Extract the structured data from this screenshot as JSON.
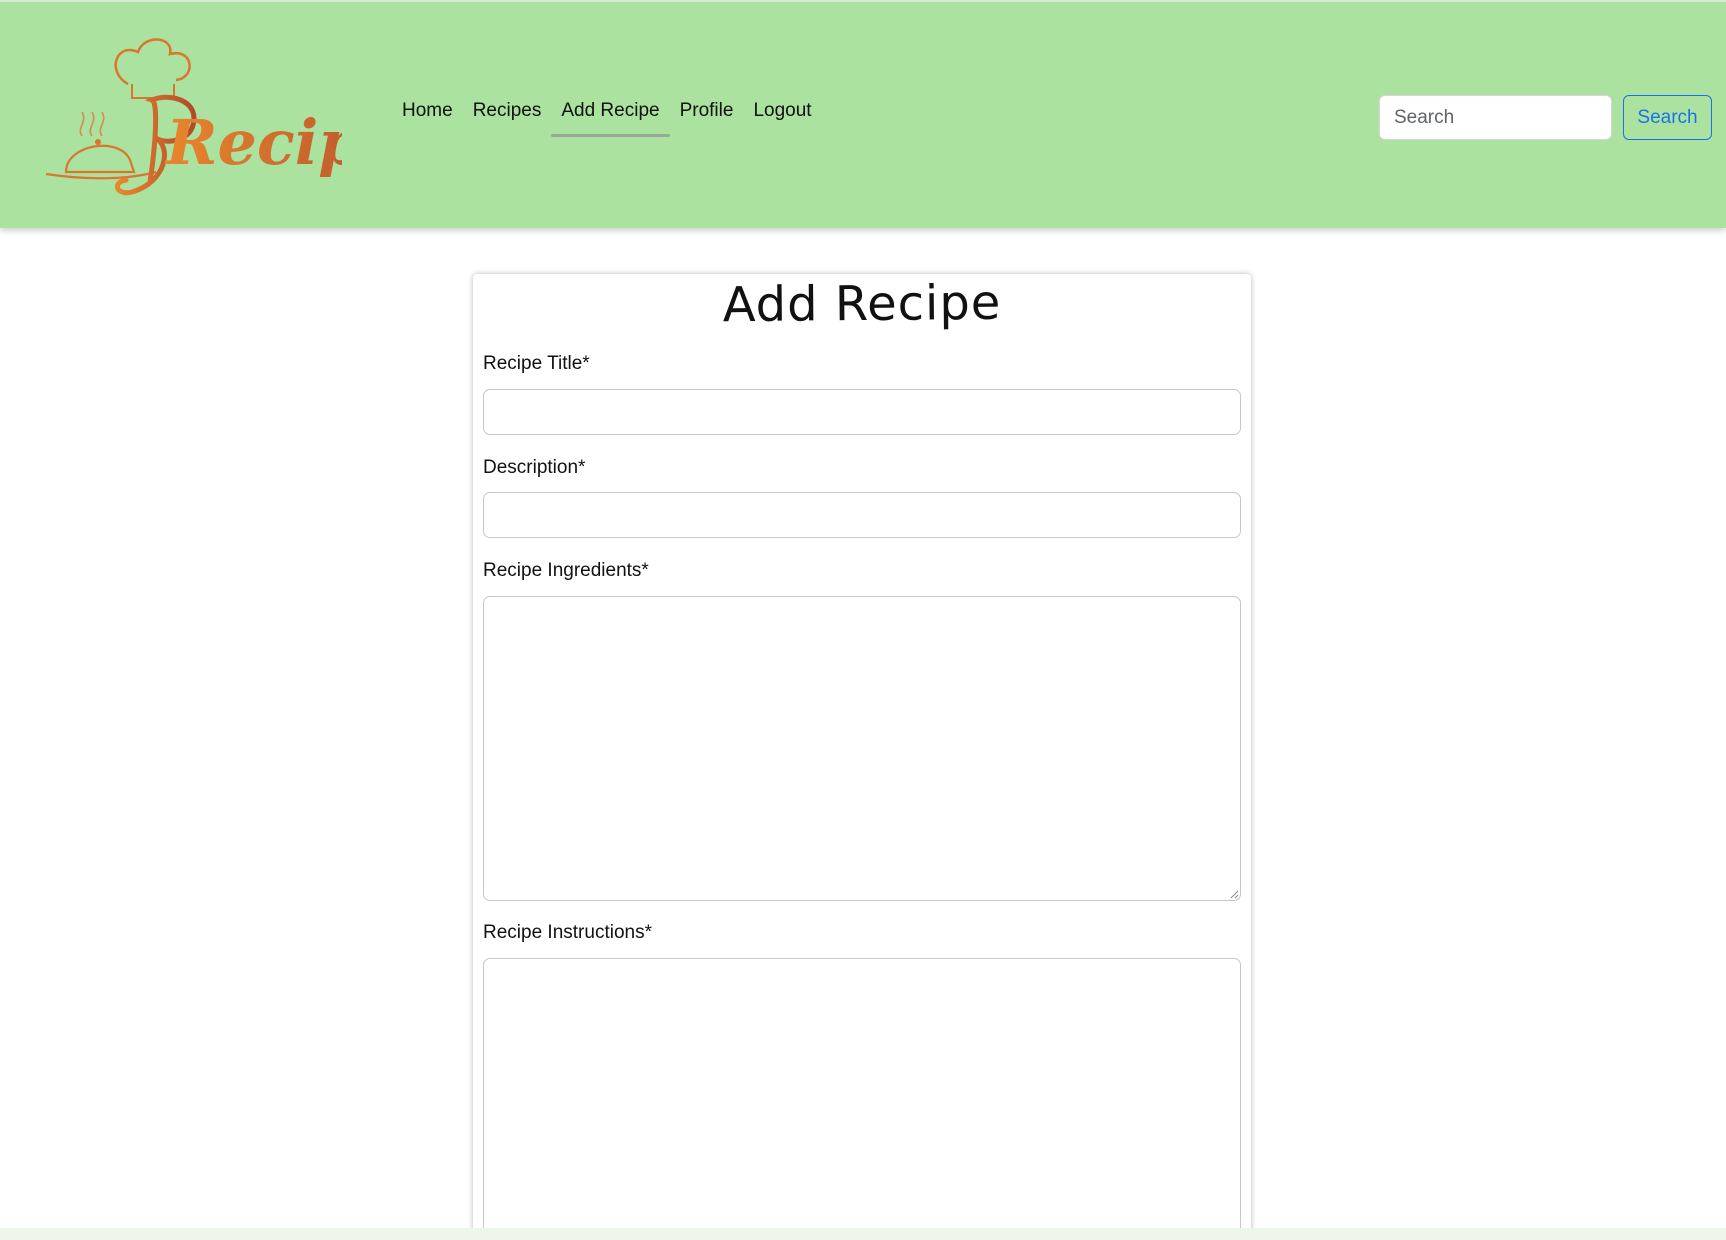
{
  "brand": {
    "logo_text": "Recipes",
    "colors": {
      "header_bg": "#abe29f",
      "logo_orange": "#e07a2a",
      "logo_brown": "#b4552b",
      "accent_blue": "#1a73e8"
    }
  },
  "nav": {
    "items": [
      {
        "label": "Home",
        "active": false
      },
      {
        "label": "Recipes",
        "active": false
      },
      {
        "label": "Add Recipe",
        "active": true
      },
      {
        "label": "Profile",
        "active": false
      },
      {
        "label": "Logout",
        "active": false
      }
    ]
  },
  "search": {
    "placeholder": "Search",
    "value": "",
    "button_label": "Search"
  },
  "form": {
    "title": "Add Recipe",
    "fields": {
      "title": {
        "label": "Recipe Title*",
        "value": ""
      },
      "description": {
        "label": "Description*",
        "value": ""
      },
      "ingredients": {
        "label": "Recipe Ingredients*",
        "value": ""
      },
      "instructions": {
        "label": "Recipe Instructions*",
        "value": ""
      }
    }
  }
}
